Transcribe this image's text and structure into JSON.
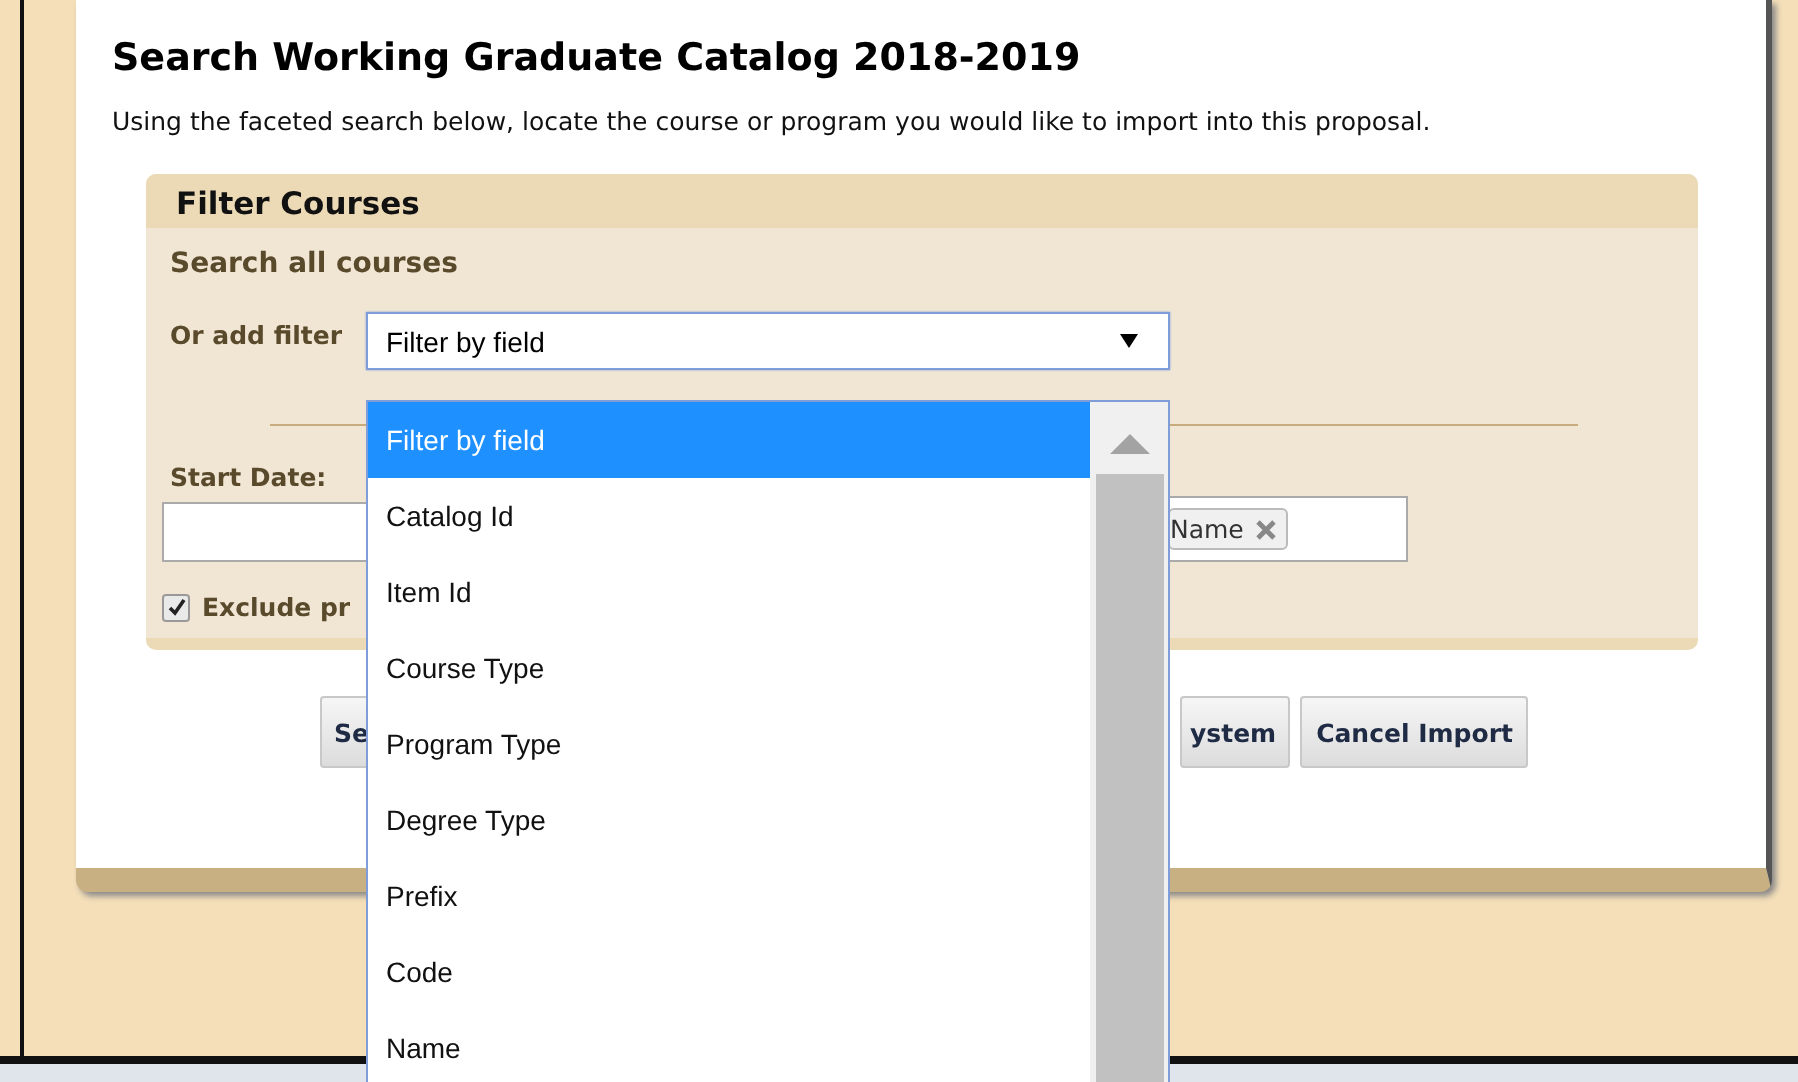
{
  "dialog": {
    "title": "Search Working Graduate Catalog 2018-2019",
    "description": "Using the faceted search below, locate the course or program you would like to import into this proposal."
  },
  "filter_panel": {
    "title": "Filter Courses",
    "search_label": "Search all courses",
    "filter_label": "Or add filter",
    "filter_select": {
      "value": "Filter by field",
      "expanded": true
    },
    "start_date": {
      "label": "Start Date:"
    },
    "tags": [
      "Name"
    ],
    "exclude": {
      "label": "Exclude pr",
      "checked": true
    }
  },
  "buttons": [
    "Se",
    "ystem",
    "Cancel Import"
  ],
  "dropdown_options": [
    {
      "label": "Filter by field",
      "selected": true
    },
    {
      "label": "Catalog Id",
      "selected": false
    },
    {
      "label": "Item Id",
      "selected": false
    },
    {
      "label": "Course Type",
      "selected": false
    },
    {
      "label": "Program Type",
      "selected": false
    },
    {
      "label": "Degree Type",
      "selected": false
    },
    {
      "label": "Prefix",
      "selected": false
    },
    {
      "label": "Code",
      "selected": false
    },
    {
      "label": "Name",
      "selected": false
    }
  ]
}
